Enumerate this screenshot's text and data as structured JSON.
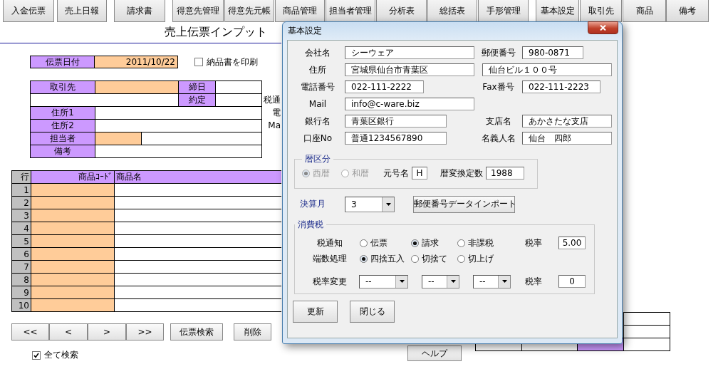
{
  "toolbar": [
    "入金伝票",
    "売上日報",
    "請求書",
    "得意先管理",
    "得意先元帳",
    "商品管理",
    "担当者管理",
    "分析表",
    "総括表",
    "手形管理",
    "基本設定",
    "取引先",
    "商品",
    "備考"
  ],
  "page_title": "売上伝票インプット",
  "slip_date": {
    "label": "伝票日付",
    "value": "2011/10/22"
  },
  "print_delivery": {
    "label": "納品書を印刷",
    "checked": false
  },
  "customer_form": {
    "customer_label": "取引先",
    "closing_day_label": "締日",
    "agreement_label": "約定",
    "tax_notice_label": "税通",
    "address1_label": "住所1",
    "phone_label": "電",
    "address2_label": "住所2",
    "mail_label": "Ma",
    "staff_label": "担当者",
    "note_label": "備考"
  },
  "items": {
    "columns": [
      "行",
      "商品ｺｰﾄﾞ",
      "商品名"
    ],
    "rows": [
      "1",
      "2",
      "3",
      "4",
      "5",
      "6",
      "7",
      "8",
      "9",
      "10"
    ]
  },
  "nav_buttons": [
    "<<",
    "<",
    ">",
    ">>",
    "伝票検索",
    "削除"
  ],
  "search_all": {
    "label": "全て検索",
    "checked": true
  },
  "help_button": "ヘルプ",
  "dialog": {
    "title": "基本設定",
    "company": {
      "label": "会社名",
      "value": "シーウェア"
    },
    "postal": {
      "label": "郵便番号",
      "value": "980-0871"
    },
    "address": {
      "label": "住所",
      "value": "宮城県仙台市青葉区",
      "value_2": "仙台ビル１００号"
    },
    "phone": {
      "label": "電話番号",
      "value": "022-111-2222"
    },
    "fax": {
      "label": "Fax番号",
      "value": "022-111-2223"
    },
    "mail": {
      "label": "Mail",
      "value": "info@c-ware.biz"
    },
    "bank": {
      "label": "銀行名",
      "value": "青葉区銀行"
    },
    "branch": {
      "label": "支店名",
      "value": "あかさたな支店"
    },
    "account": {
      "label": "口座No",
      "value": "普通1234567890"
    },
    "holder": {
      "label": "名義人名",
      "value": "仙台　四郎"
    },
    "calendar": {
      "title": "暦区分",
      "disabled": true,
      "options": [
        {
          "label": "西暦",
          "selected": true
        },
        {
          "label": "和暦",
          "selected": false
        }
      ],
      "era_label": "元号名",
      "era_value": "H",
      "offset_label": "暦変換定数",
      "offset_value": "1988"
    },
    "fiscal_month": {
      "label": "決算月",
      "value": "3"
    },
    "import_button": "郵便番号データインポート",
    "tax": {
      "title": "消費税",
      "notice": {
        "label": "税通知",
        "options": [
          {
            "label": "伝票",
            "selected": false
          },
          {
            "label": "請求",
            "selected": true
          },
          {
            "label": "非課税",
            "selected": false
          }
        ]
      },
      "rounding": {
        "label": "端数処理",
        "options": [
          {
            "label": "四捨五入",
            "selected": true
          },
          {
            "label": "切捨て",
            "selected": false
          },
          {
            "label": "切上げ",
            "selected": false
          }
        ]
      },
      "rate_label": "税率",
      "rate_value": "5.00",
      "change_label": "税率変更",
      "change_combos": [
        "--",
        "--",
        "--"
      ],
      "new_rate_label": "税率",
      "new_rate_value": "0"
    },
    "buttons": [
      "更新",
      "閉じる"
    ]
  }
}
